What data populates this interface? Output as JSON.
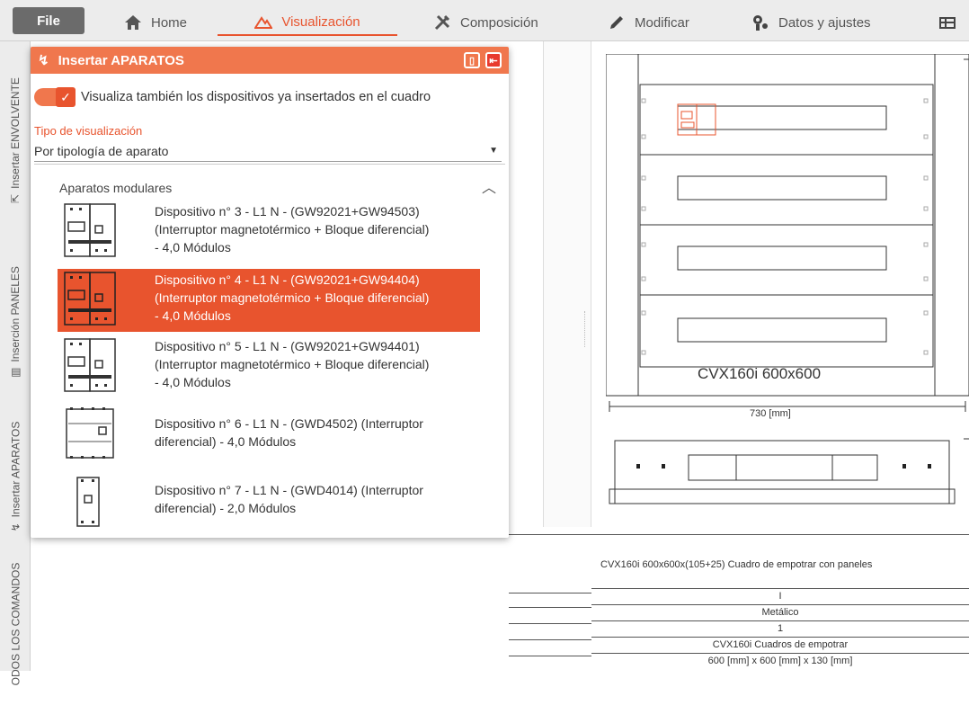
{
  "menu": {
    "file": "File",
    "tabs": [
      {
        "label": "Home",
        "icon": "home-icon"
      },
      {
        "label": "Visualización",
        "icon": "mountain-icon",
        "active": true
      },
      {
        "label": "Composición",
        "icon": "tools-icon"
      },
      {
        "label": "Modificar",
        "icon": "pencil-icon"
      },
      {
        "label": "Datos y ajustes",
        "icon": "settings-gear-icon"
      }
    ]
  },
  "sidebar": {
    "items": [
      {
        "label": "Insertar ENVOLVENTE",
        "icon": "insert-enclosure-icon"
      },
      {
        "label": "Inserción PANELES",
        "icon": "panel-icon"
      },
      {
        "label": "Insertar APARATOS",
        "icon": "insert-device-icon"
      },
      {
        "label": "ODOS LOS COMANDOS",
        "icon": ""
      }
    ]
  },
  "panel": {
    "title": "Insertar APARATOS",
    "toggle_label": "Visualiza también los dispositivos ya insertados en el cuadro",
    "toggle_on": true,
    "view_type_label": "Tipo de visualización",
    "view_type_value": "Por tipología de aparato",
    "group": "Aparatos modulares",
    "devices": [
      {
        "line1": "Dispositivo n° 3 - L1 N - (GW92021+GW94503)",
        "line2": "(Interruptor magnetotérmico + Bloque diferencial)",
        "line3": "- 4,0 Módulos",
        "selected": false
      },
      {
        "line1": "Dispositivo n° 4 - L1 N - (GW92021+GW94404)",
        "line2": "(Interruptor magnetotérmico + Bloque diferencial)",
        "line3": "- 4,0 Módulos",
        "selected": true
      },
      {
        "line1": "Dispositivo n° 5 - L1 N - (GW92021+GW94401)",
        "line2": "(Interruptor magnetotérmico + Bloque diferencial)",
        "line3": "- 4,0 Módulos",
        "selected": false
      },
      {
        "line1": "Dispositivo n° 6 - L1 N - (GWD4502) (Interruptor",
        "line2": "diferencial) - 4,0 Módulos",
        "line3": "",
        "selected": false
      },
      {
        "line1": "Dispositivo n° 7 - L1 N - (GWD4014) (Interruptor",
        "line2": "diferencial) - 2,0 Módulos",
        "line3": "",
        "selected": false
      }
    ]
  },
  "drawing": {
    "enclosure_label": "CVX160i   600x600",
    "width_label": "730 [mm]",
    "spec_title": "CVX160i 600x600x(105+25) Cuadro de empotrar con paneles",
    "spec_rows": [
      "I",
      "Metálico",
      "1",
      "CVX160i Cuadros de empotrar",
      "600 [mm] x 600 [mm] x 130 [mm]"
    ]
  },
  "colors": {
    "accent": "#e8542e",
    "header": "#f0774d"
  }
}
